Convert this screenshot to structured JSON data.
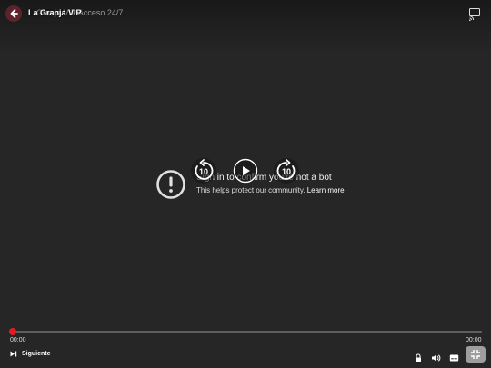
{
  "header": {
    "app_title": "La Granja VIP",
    "video_title": "Granja VIP Acceso 24/7"
  },
  "bot_message": {
    "title": "Sign in to confirm you're not a bot",
    "subtitle": "This helps protect our community.",
    "link_label": "Learn more"
  },
  "controls": {
    "rewind_label": "10",
    "forward_label": "10",
    "time_current": "00:00",
    "time_total": "00:00",
    "progress": 0,
    "next_label": "Siguiente"
  },
  "colors": {
    "background": "#262626",
    "accent": "#e31b23"
  },
  "icons": [
    "back-arrow-icon",
    "cast-icon",
    "warning-icon",
    "rewind-10-icon",
    "play-icon",
    "forward-10-icon",
    "skip-next-icon",
    "lock-icon",
    "volume-icon",
    "subtitles-icon",
    "fullscreen-exit-icon"
  ]
}
